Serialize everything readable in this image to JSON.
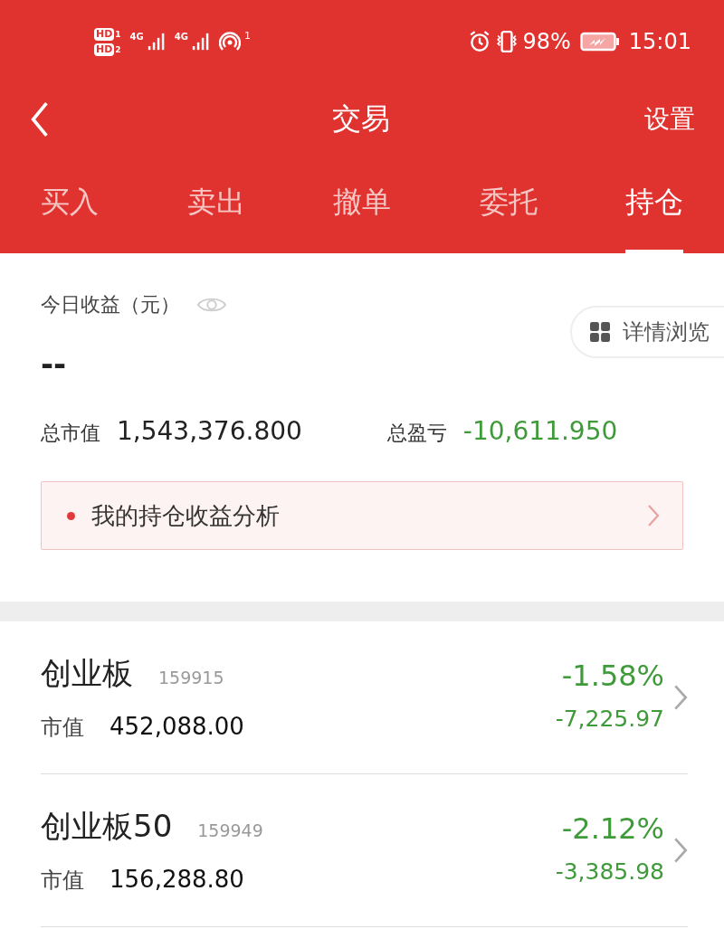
{
  "status_bar": {
    "sim_badges": [
      {
        "label": "HD",
        "index": "1"
      },
      {
        "label": "HD",
        "index": "2"
      }
    ],
    "networks": [
      "4G",
      "4G"
    ],
    "hotspot_count": "1",
    "battery": "98%",
    "time": "15:01"
  },
  "header": {
    "title": "交易",
    "action": "设置"
  },
  "tabs": [
    {
      "label": "买入",
      "selected": false
    },
    {
      "label": "卖出",
      "selected": false
    },
    {
      "label": "撤单",
      "selected": false
    },
    {
      "label": "委托",
      "selected": false
    },
    {
      "label": "持仓",
      "selected": true
    }
  ],
  "summary": {
    "today_label": "今日收益（元）",
    "today_value": "--",
    "detail_button": "详情浏览",
    "total_value_label": "总市值",
    "total_value": "1,543,376.800",
    "total_pl_label": "总盈亏",
    "total_pl": "-10,611.950",
    "analysis_link": "我的持仓收益分析"
  },
  "holdings": [
    {
      "name": "创业板",
      "code": "159915",
      "value_label": "市值",
      "value": "452,088.00",
      "change_pct": "-1.58%",
      "change": "-7,225.97"
    },
    {
      "name": "创业板50",
      "code": "159949",
      "value_label": "市值",
      "value": "156,288.80",
      "change_pct": "-2.12%",
      "change": "-3,385.98"
    }
  ]
}
